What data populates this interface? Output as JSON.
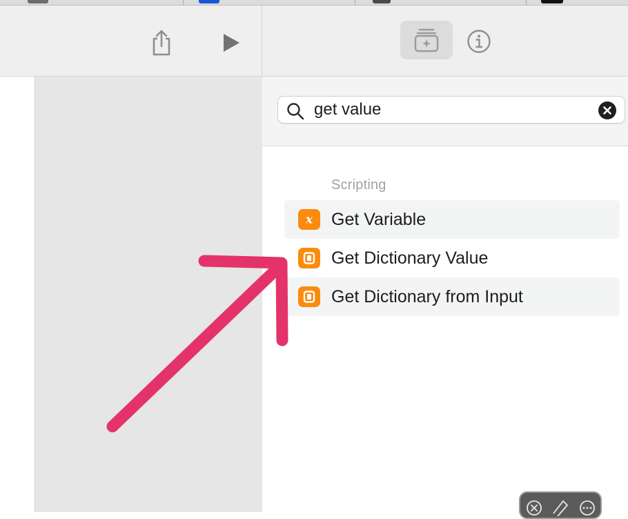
{
  "toolbar": {
    "share_icon": "share-icon",
    "run_icon": "play-icon",
    "library_icon": "action-library-icon",
    "info_icon": "info-icon"
  },
  "search": {
    "value": "get value",
    "placeholder": "",
    "icon": "magnifier-icon",
    "clear_icon": "clear-x-icon"
  },
  "results": {
    "section_title": "Scripting",
    "items": [
      {
        "label": "Get Variable",
        "icon": "variable-x-icon",
        "icon_color": "#fb8b0d",
        "highlighted": true
      },
      {
        "label": "Get Dictionary Value",
        "icon": "dictionary-icon",
        "icon_color": "#fb8b0d",
        "highlighted": false
      },
      {
        "label": "Get Dictionary from Input",
        "icon": "dictionary-icon",
        "icon_color": "#fb8b0d",
        "highlighted": true
      }
    ]
  },
  "annotation": {
    "type": "arrow",
    "color": "#e4336b"
  },
  "colors": {
    "accent": "#fb8b0d",
    "toolbar_bg": "#efefef",
    "canvas_gray": "#e6e6e6"
  }
}
